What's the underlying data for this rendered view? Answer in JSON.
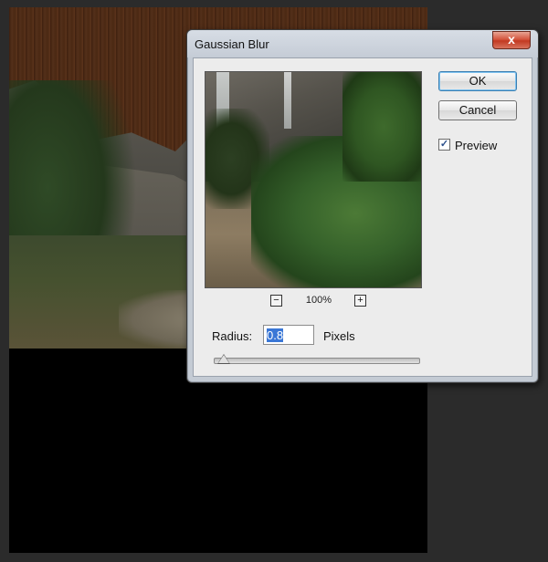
{
  "dialog": {
    "title": "Gaussian Blur",
    "close_glyph": "x",
    "ok_label": "OK",
    "cancel_label": "Cancel",
    "preview_label": "Preview",
    "preview_checked": true,
    "check_glyph": "✓",
    "zoom_out_glyph": "−",
    "zoom_in_glyph": "+",
    "zoom_level": "100%",
    "radius_label": "Radius:",
    "radius_value": "0.8",
    "radius_units": "Pixels",
    "radius_slider_fraction": 0.01
  },
  "colors": {
    "dialog_bg": "#c4cbd4",
    "client_bg": "#ececec",
    "close_button": "#c23a22",
    "selection": "#3a77d6",
    "app_bg": "#2b2b2b"
  }
}
